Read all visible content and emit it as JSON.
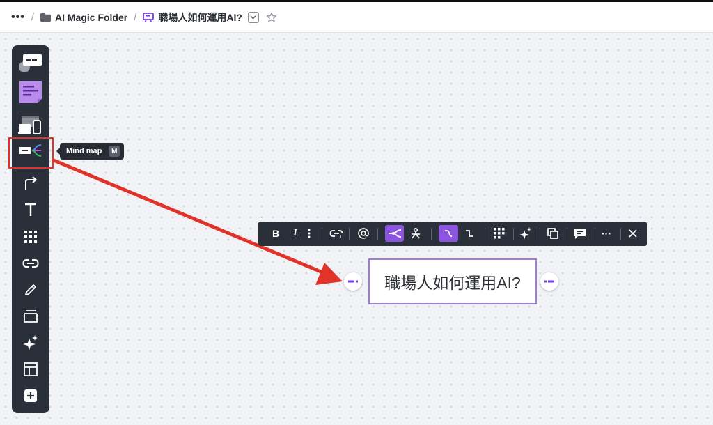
{
  "header": {
    "more_label": "•••",
    "separator": "/",
    "folder_label": "AI Magic Folder",
    "board_title": "職場人如何運用AI?"
  },
  "toolbar": {
    "tools": [
      {
        "name": "templates-icon"
      },
      {
        "name": "sticky-note-icon"
      },
      {
        "name": "wireframe-devices-icon"
      },
      {
        "name": "mind-map-icon"
      },
      {
        "name": "connection-line-icon"
      },
      {
        "name": "text-icon"
      },
      {
        "name": "grid-apps-icon"
      },
      {
        "name": "link-icon"
      },
      {
        "name": "pen-icon"
      },
      {
        "name": "frame-icon"
      },
      {
        "name": "ai-sparkle-icon"
      },
      {
        "name": "layout-icon"
      },
      {
        "name": "add-icon"
      }
    ]
  },
  "tooltip": {
    "label": "Mind map",
    "shortcut": "M"
  },
  "context_toolbar": {
    "bold": "B",
    "italic": "I",
    "more_label": "···"
  },
  "mindmap": {
    "node_text": "職場人如何運用AI?"
  },
  "colors": {
    "toolbar_bg": "#2a303a",
    "accent_purple": "#8b55e0",
    "annotation_red": "#e0332a",
    "node_border": "#9f7bd9"
  }
}
